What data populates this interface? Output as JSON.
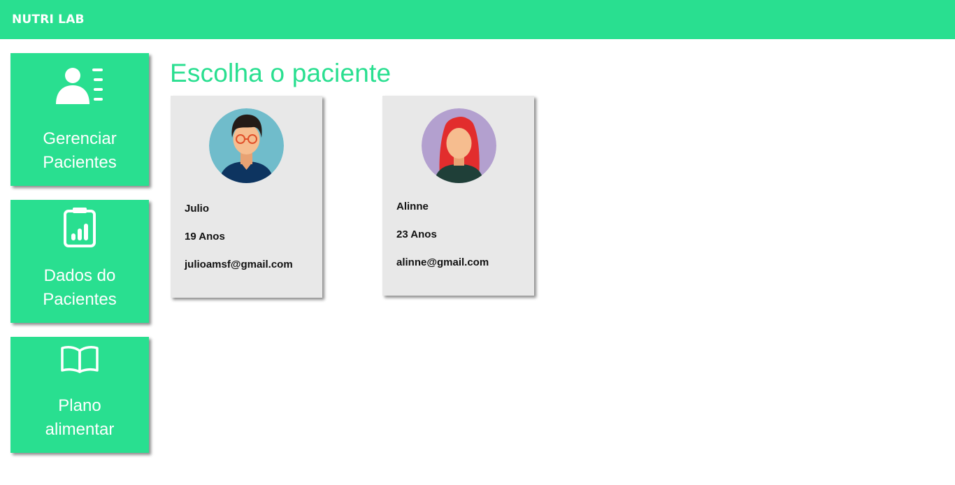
{
  "header": {
    "brand": "NUTRI LAB"
  },
  "sidebar": {
    "items": [
      {
        "label_line1": "Gerenciar",
        "label_line2": "Pacientes",
        "icon": "users-list-icon"
      },
      {
        "label_line1": "Dados do",
        "label_line2": "Pacientes",
        "icon": "clipboard-chart-icon"
      },
      {
        "label_line1": "Plano",
        "label_line2": "alimentar",
        "icon": "open-book-icon"
      }
    ]
  },
  "main": {
    "title": "Escolha o paciente",
    "patients": [
      {
        "name": "Julio",
        "age": "19 Anos",
        "email": "julioamsf@gmail.com",
        "avatar": "male-avatar-glasses"
      },
      {
        "name": "Alinne",
        "age": "23 Anos",
        "email": "alinne@gmail.com",
        "avatar": "female-avatar-red-hair"
      }
    ]
  },
  "colors": {
    "accent": "#29df90",
    "card_bg": "#e8e8e8",
    "text": "#111111"
  }
}
